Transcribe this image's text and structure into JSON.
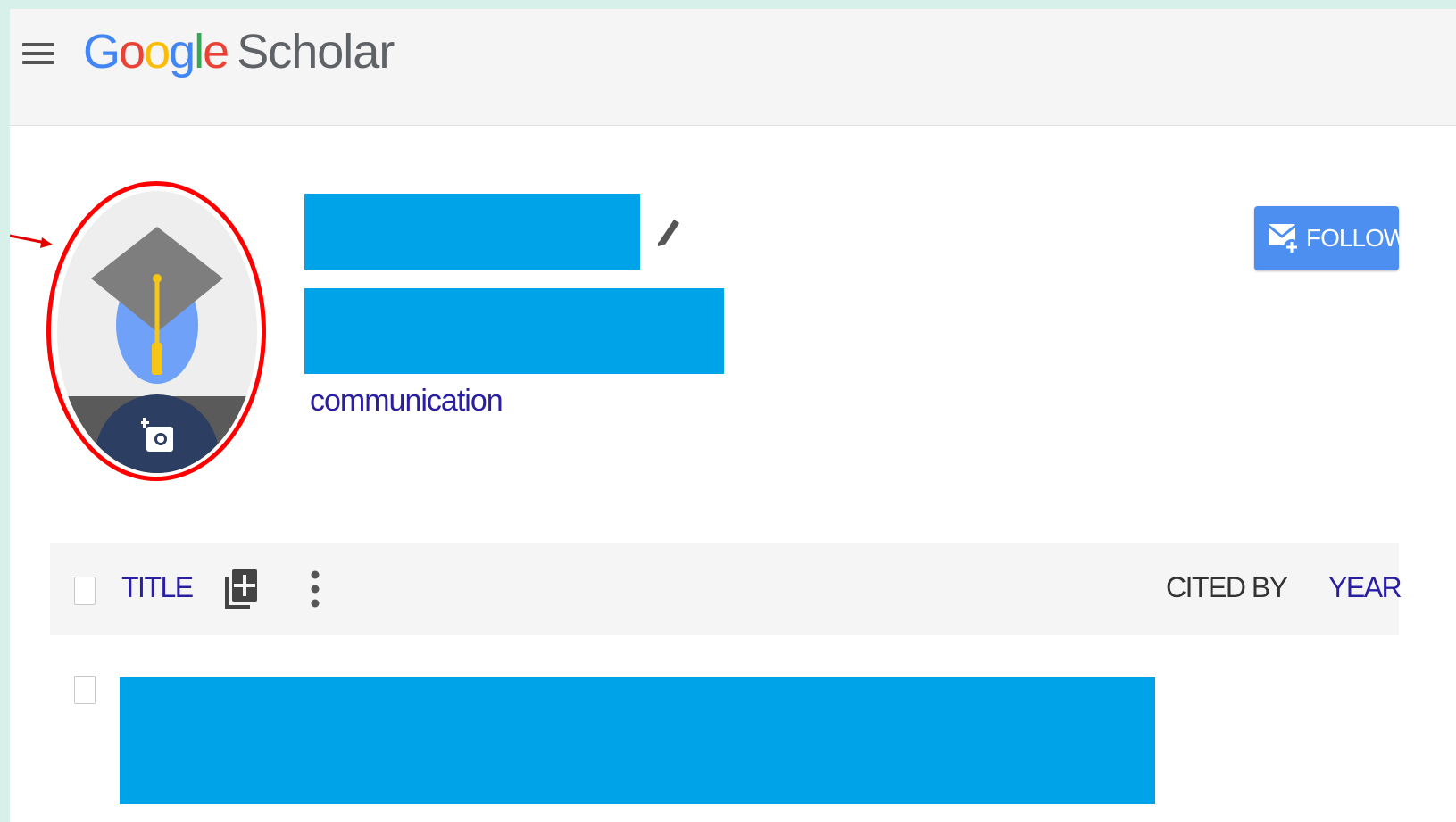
{
  "header": {
    "logo_google": "Google",
    "logo_scholar": "Scholar"
  },
  "profile": {
    "interest_link": "communication",
    "follow_label": "FOLLOW"
  },
  "table": {
    "col_title": "TITLE",
    "col_cited_by": "CITED BY",
    "col_year": "YEAR"
  },
  "colors": {
    "redaction": "#00a2e8",
    "annotation": "#ff0000",
    "link": "#2a1fa3",
    "follow_button": "#4c8ff0"
  },
  "icons": [
    "menu-icon",
    "graduation-cap-icon",
    "add-photo-icon",
    "pencil-icon",
    "follow-mail-icon",
    "add-to-library-icon",
    "more-vert-icon"
  ]
}
